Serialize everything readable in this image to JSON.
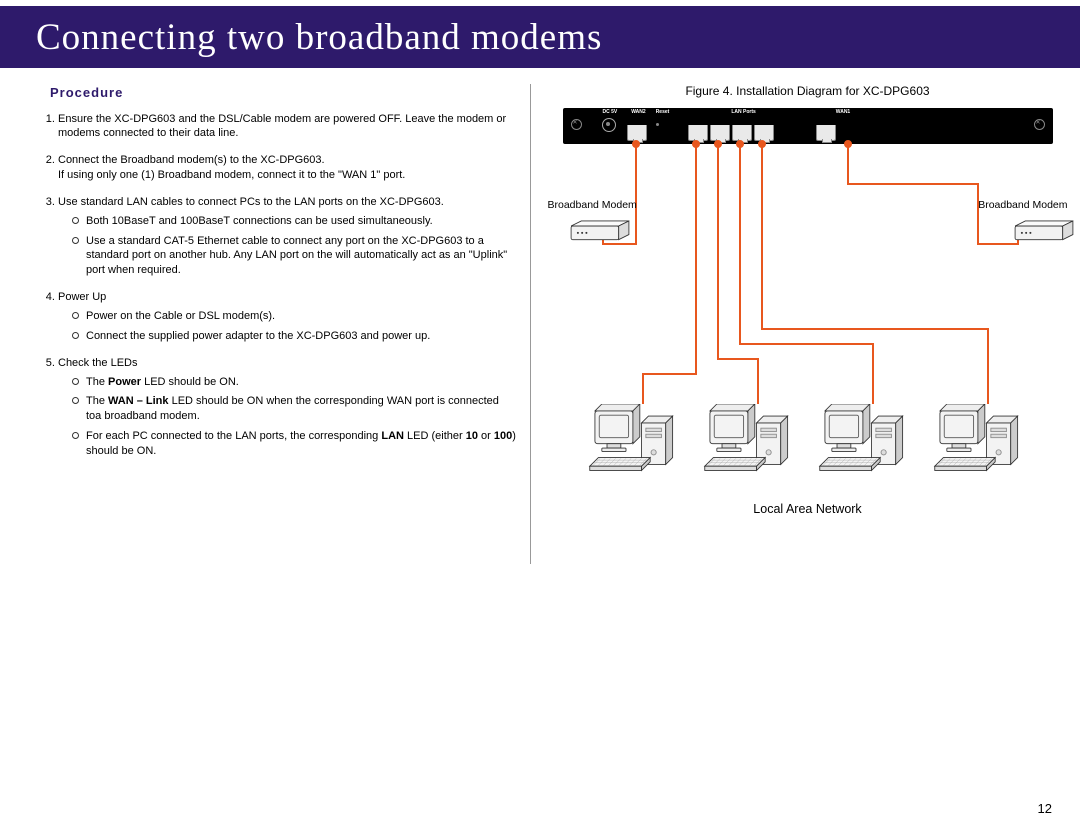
{
  "header": {
    "title": "Connecting two broadband modems"
  },
  "procedure": {
    "heading": "Procedure",
    "steps": {
      "s1": "Ensure the XC-DPG603 and the DSL/Cable modem are powered OFF. Leave the modem or modems connected to their data line.",
      "s2a": "Connect the Broadband modem(s) to the XC-DPG603.",
      "s2b": "If using only one (1) Broadband modem, connect it to the \"WAN 1\" port.",
      "s3": "Use standard LAN cables to connect PCs to the LAN ports on the XC-DPG603.",
      "s3_b1": "Both 10BaseT and 100BaseT connections can be used simultaneously.",
      "s3_b2": "Use a standard CAT-5 Ethernet cable to connect any port on the XC-DPG603 to a standard port on another hub. Any LAN port on the  will automatically act as an \"Uplink\" port when required.",
      "s4": "Power Up",
      "s4_b1": "Power on the Cable or DSL modem(s).",
      "s4_b2": "Connect the supplied power adapter to the XC-DPG603 and power up.",
      "s5": "Check the LEDs",
      "s5_b1_pre": "The ",
      "s5_b1_bold": "Power",
      "s5_b1_post": " LED should be ON.",
      "s5_b2_pre": "The ",
      "s5_b2_bold": "WAN – Link",
      "s5_b2_post": " LED should be ON when the corresponding WAN port is connected toa broadband modem.",
      "s5_b3_pre": "For each PC connected to the LAN ports, the corresponding ",
      "s5_b3_b1": "LAN",
      "s5_b3_mid": " LED (either ",
      "s5_b3_b2": "10",
      "s5_b3_mid2": " or ",
      "s5_b3_b3": "100",
      "s5_b3_post": ") should be ON."
    }
  },
  "figure": {
    "title": "Figure 4.  Installation Diagram for XC-DPG603",
    "port_labels": {
      "dc": "DC 5V",
      "wan2": "WAN2",
      "reset": "Reset",
      "lan": "LAN Ports",
      "wan1": "WAN1"
    },
    "modem_left": "Broadband Modem",
    "modem_right": "Broadband Modem",
    "lan": "Local Area Network"
  },
  "page": "12"
}
